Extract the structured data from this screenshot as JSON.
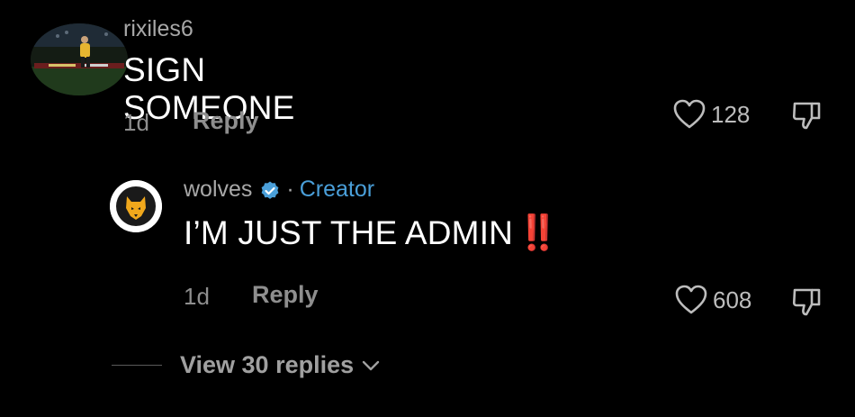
{
  "comments": [
    {
      "username": "rixiles6",
      "text": "SIGN SOMEONE",
      "age": "1d",
      "reply_label": "Reply",
      "likes": "128",
      "avatar": "player-photo-avatar",
      "like_icon": "heart-outline-icon",
      "dislike_icon": "thumbs-down-icon"
    },
    {
      "username": "wolves",
      "verified": true,
      "separator": "·",
      "badge": "Creator",
      "text": "I’M JUST THE ADMIN",
      "emoji": "‼️",
      "age": "1d",
      "reply_label": "Reply",
      "likes": "608",
      "avatar": "wolves-logo-avatar",
      "like_icon": "heart-outline-icon",
      "dislike_icon": "thumbs-down-icon"
    }
  ],
  "view_replies": {
    "label": "View 30 replies",
    "icon": "chevron-down-icon"
  },
  "colors": {
    "background": "#000000",
    "creator": "#4a9fd9",
    "verified": "#4a9fd9",
    "emoji_red": "#e63946",
    "wolves_gold": "#f0a81c"
  }
}
